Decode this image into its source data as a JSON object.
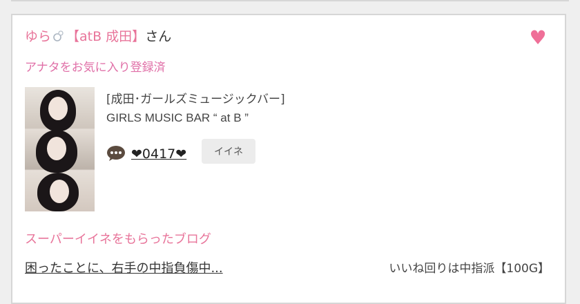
{
  "card": {
    "user_name": "ゆら",
    "user_name_emoji": "💍",
    "shop_tag": "【atB 成田】",
    "honorific": "さん",
    "favorite_note": "アナタをお気に入り登録済",
    "shop_category": "[成田･ガールズミュージックバー]",
    "shop_name": "GIRLS MUSIC BAR “ at B ”",
    "commenter": "❤0417❤",
    "iine_label": "イイネ",
    "colors": {
      "accent": "#e8749a",
      "heart": "#ef6f98"
    }
  },
  "super_iine": {
    "heading": "スーパーイイネをもらったブログ",
    "blog_title": "困ったことに、右手の中指負傷中...",
    "blog_meta": "いいね回りは中指派【100G】"
  },
  "icons": [
    "heart-icon",
    "chat-bubble-icon",
    "ring-icon"
  ]
}
